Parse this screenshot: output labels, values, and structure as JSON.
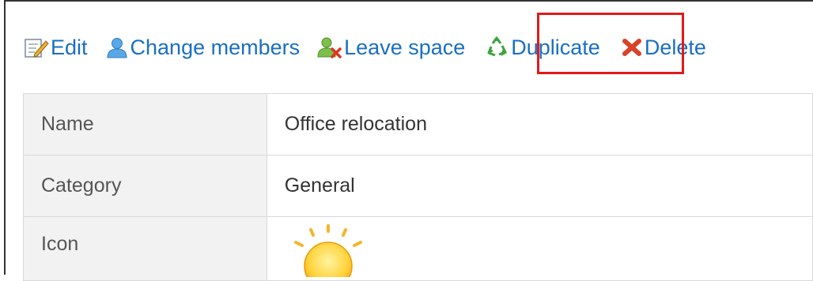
{
  "toolbar": {
    "edit_label": "Edit",
    "change_members_label": "Change members",
    "leave_space_label": "Leave space",
    "duplicate_label": "Duplicate",
    "delete_label": "Delete"
  },
  "details": {
    "rows": [
      {
        "label": "Name",
        "value": "Office relocation"
      },
      {
        "label": "Category",
        "value": "General"
      },
      {
        "label": "Icon",
        "value": ""
      }
    ],
    "icon": "sun-icon"
  },
  "colors": {
    "link": "#1a6fc0",
    "highlight": "#e11a1a",
    "label_bg": "#f2f2f2",
    "border": "#d9d9d9"
  }
}
